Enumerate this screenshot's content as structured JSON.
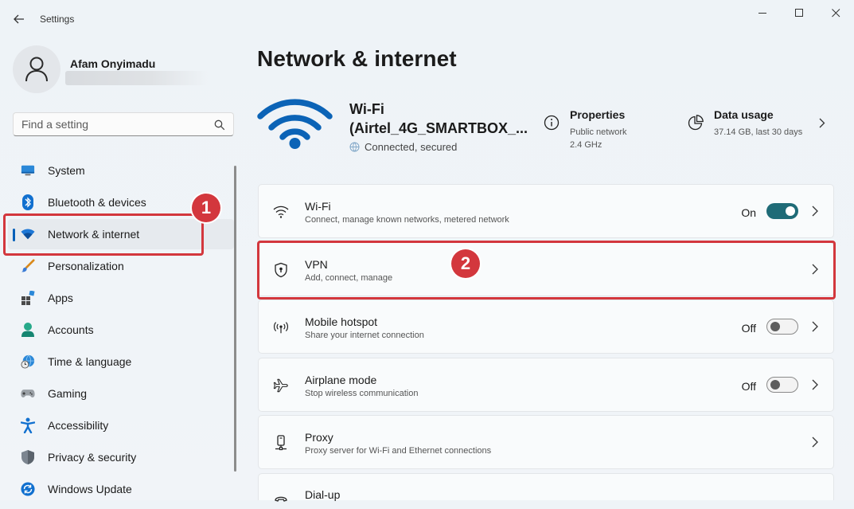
{
  "window": {
    "title": "Settings"
  },
  "profile": {
    "name": "Afam Onyimadu"
  },
  "search": {
    "placeholder": "Find a setting"
  },
  "sidebar": {
    "items": [
      {
        "label": "System",
        "icon": "system-icon"
      },
      {
        "label": "Bluetooth & devices",
        "icon": "bluetooth-icon"
      },
      {
        "label": "Network & internet",
        "icon": "wifi-icon",
        "selected": true
      },
      {
        "label": "Personalization",
        "icon": "paintbrush-icon"
      },
      {
        "label": "Apps",
        "icon": "apps-icon"
      },
      {
        "label": "Accounts",
        "icon": "accounts-icon"
      },
      {
        "label": "Time & language",
        "icon": "globe-clock-icon"
      },
      {
        "label": "Gaming",
        "icon": "gamepad-icon"
      },
      {
        "label": "Accessibility",
        "icon": "accessibility-icon"
      },
      {
        "label": "Privacy & security",
        "icon": "shield-icon"
      },
      {
        "label": "Windows Update",
        "icon": "update-icon"
      }
    ]
  },
  "annotations": {
    "one": "1",
    "two": "2"
  },
  "main": {
    "title": "Network & internet",
    "hero": {
      "name_line1": "Wi-Fi",
      "name_line2": "(Airtel_4G_SMARTBOX_...",
      "status": "Connected, secured",
      "properties": {
        "title": "Properties",
        "line1": "Public network",
        "line2": "2.4 GHz"
      },
      "data_usage": {
        "title": "Data usage",
        "line1": "37.14 GB, last 30 days"
      }
    },
    "cards": [
      {
        "title": "Wi-Fi",
        "subtitle": "Connect, manage known networks, metered network",
        "state": "On",
        "toggle": "on"
      },
      {
        "title": "VPN",
        "subtitle": "Add, connect, manage"
      },
      {
        "title": "Mobile hotspot",
        "subtitle": "Share your internet connection",
        "state": "Off",
        "toggle": "off"
      },
      {
        "title": "Airplane mode",
        "subtitle": "Stop wireless communication",
        "state": "Off",
        "toggle": "off"
      },
      {
        "title": "Proxy",
        "subtitle": "Proxy server for Wi-Fi and Ethernet connections"
      },
      {
        "title": "Dial-up",
        "subtitle": ""
      }
    ]
  },
  "colors": {
    "accent": "#005fb8",
    "toggle_on": "#1f6b77",
    "annotation": "#d3373d",
    "wifi_hero": "#0b63b6"
  }
}
